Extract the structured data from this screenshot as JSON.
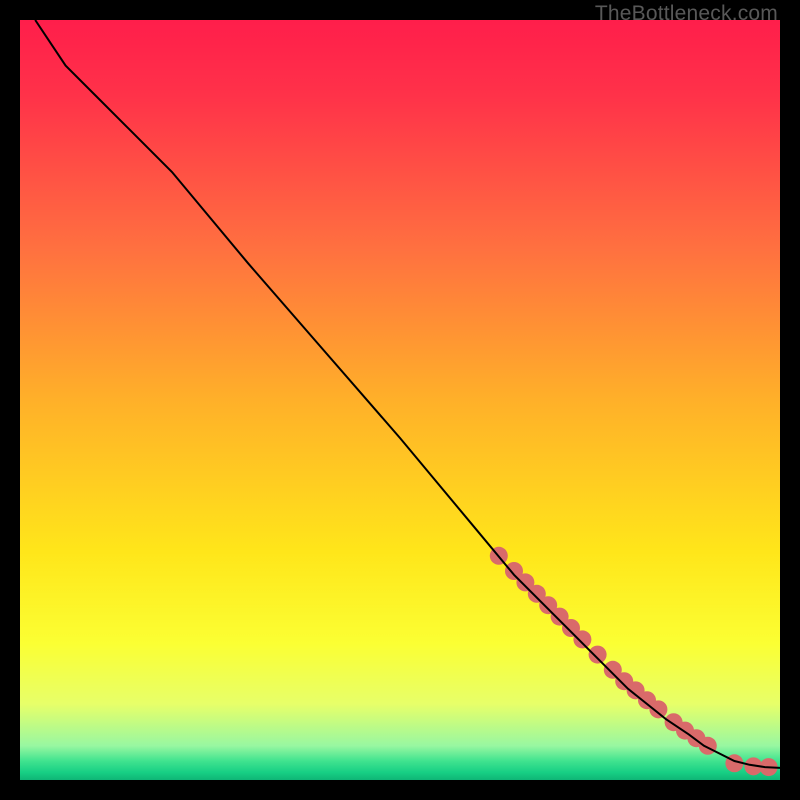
{
  "watermark": "TheBottleneck.com",
  "gradient_stops": [
    {
      "offset": 0.0,
      "color": "#ff1e4b"
    },
    {
      "offset": 0.1,
      "color": "#ff3249"
    },
    {
      "offset": 0.3,
      "color": "#ff7040"
    },
    {
      "offset": 0.5,
      "color": "#ffb029"
    },
    {
      "offset": 0.7,
      "color": "#ffe61a"
    },
    {
      "offset": 0.82,
      "color": "#fbff33"
    },
    {
      "offset": 0.9,
      "color": "#e7ff69"
    },
    {
      "offset": 0.955,
      "color": "#98f7a1"
    },
    {
      "offset": 0.975,
      "color": "#40e38f"
    },
    {
      "offset": 0.99,
      "color": "#17cf84"
    },
    {
      "offset": 1.0,
      "color": "#0fb576"
    }
  ],
  "marker_color": "#d96a6a",
  "marker_radius": 9,
  "line_color": "#000000",
  "chart_data": {
    "type": "line",
    "title": "",
    "xlabel": "",
    "ylabel": "",
    "xlim": [
      0,
      100
    ],
    "ylim": [
      0,
      100
    ],
    "series": [
      {
        "name": "curve",
        "x": [
          2,
          4,
          6,
          10,
          20,
          30,
          40,
          50,
          60,
          65,
          70,
          75,
          80,
          85,
          88,
          90,
          92,
          94,
          96,
          98,
          100
        ],
        "y": [
          100,
          97,
          94,
          90,
          80,
          68,
          56.5,
          45,
          33,
          27,
          22,
          17,
          12,
          8,
          6,
          4.5,
          3.5,
          2.5,
          2,
          1.7,
          1.6
        ]
      }
    ],
    "markers": {
      "name": "highlight",
      "x": [
        63,
        65,
        66.5,
        68,
        69.5,
        71,
        72.5,
        74,
        76,
        78,
        79.5,
        81,
        82.5,
        84,
        86,
        87.5,
        89,
        90.5,
        94,
        96.5,
        98.5
      ],
      "y": [
        29.5,
        27.5,
        26,
        24.5,
        23,
        21.5,
        20,
        18.5,
        16.5,
        14.5,
        13,
        11.8,
        10.5,
        9.3,
        7.6,
        6.5,
        5.5,
        4.5,
        2.2,
        1.8,
        1.7
      ]
    }
  }
}
